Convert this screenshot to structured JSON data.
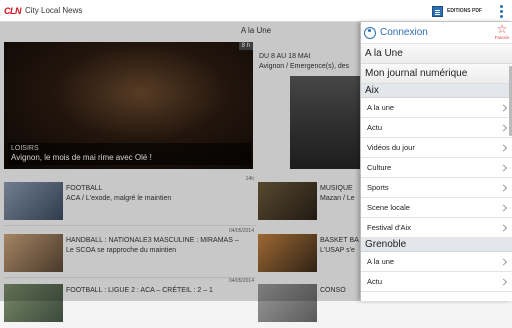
{
  "app": {
    "logo": "CLN",
    "title": "City Local News"
  },
  "toolbar": {
    "pdf_label": "EDITIONS PDF"
  },
  "main": {
    "section_title": "A la Une",
    "lead": {
      "badge": "8 h",
      "category": "LOISIRS",
      "title": "Avignon, le mois de mai rime avec Olé !"
    },
    "second": {
      "line1": "DU 8 AU 18 MAI",
      "line2": "Avignon / Emergence(s), des"
    },
    "articles": [
      {
        "meta": "14h",
        "title": "FOOTBALL",
        "subtitle": "ACA / L'exode, malgré le maintien"
      },
      {
        "meta": "04/05/2014",
        "title": "HANDBALL : NATIONALE3 MASCULINE : MIRAMAS –",
        "subtitle": "Le SCOA se rapproche du maintien"
      },
      {
        "meta": "04/05/2014",
        "title": "FOOTBALL : LIGUE 2 : ACA – CRÉTEIL : 2 – 1",
        "subtitle": ""
      }
    ],
    "right_articles": [
      {
        "title": "MUSIQUE",
        "subtitle": "Mazan / Le"
      },
      {
        "title": "BASKET BA",
        "subtitle": "L'USAP s'e"
      },
      {
        "title": "CONSO",
        "subtitle": ""
      }
    ]
  },
  "drawer": {
    "connexion": "Connexion",
    "favoris": "Favoris",
    "top_items": [
      "A la Une",
      "Mon journal numérique"
    ],
    "groups": [
      {
        "name": "Aix",
        "items": [
          "A la une",
          "Actu",
          "Vidéos du jour",
          "Culture",
          "Sports",
          "Scene locale",
          "Festival d'Aix"
        ]
      },
      {
        "name": "Grenoble",
        "items": [
          "A la une",
          "Actu"
        ]
      }
    ]
  }
}
